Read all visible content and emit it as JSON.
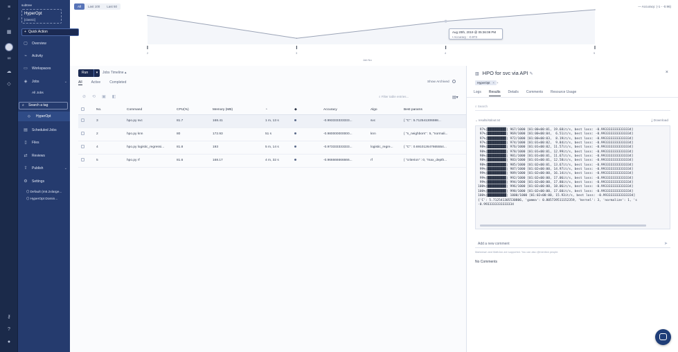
{
  "workspace": {
    "label": "subtree"
  },
  "project": {
    "name": "HyperOpt",
    "tag": "[classic]"
  },
  "sidebar": {
    "quick_action": "Quick Action",
    "items": [
      {
        "label": "Overview",
        "icon": "overview-icon"
      },
      {
        "label": "Activity",
        "icon": "activity-icon"
      },
      {
        "label": "Workspaces",
        "icon": "monitor-icon"
      },
      {
        "label": "Jobs",
        "icon": "jobs-icon"
      },
      {
        "label": "Scheduled Jobs",
        "icon": "calendar-icon"
      },
      {
        "label": "Files",
        "icon": "folder-icon"
      },
      {
        "label": "Reviews",
        "icon": "review-icon"
      },
      {
        "label": "Publish",
        "icon": "publish-icon"
      },
      {
        "label": "Settings",
        "icon": "gear-icon"
      }
    ],
    "jobs_sub": "All Jobs",
    "search_tag": "Search a tag",
    "hyperopt_tag": "HyperOpt",
    "settings_sub": [
      "Default (m5.2xlarge...",
      "HyperOpt Domin..."
    ]
  },
  "chart": {
    "filters": [
      "All",
      "Last 100",
      "Last 50"
    ],
    "active_filter": "All",
    "legend": "Accuracy: (-1 - -0.96)",
    "tooltip_line1": "Aug 20th, 2019 @ 05:36:08 PM",
    "tooltip_line2": "• Accuracy : -0.973",
    "xticks": [
      "2",
      "3",
      "4",
      "5"
    ],
    "xlabel": "Job No"
  },
  "chart_data": {
    "type": "line",
    "x": [
      2,
      3,
      4,
      5
    ],
    "series": [
      {
        "values": [
          -0.9667,
          -0.993,
          -0.9733,
          -0.96
        ]
      }
    ],
    "xlabel": "Job No",
    "ylim": [
      -1,
      -0.96
    ]
  },
  "jobs": {
    "run_label": "Run",
    "timeline_label": "Jobs Timeline",
    "tabs": [
      "All",
      "Active",
      "Completed"
    ],
    "show_archived": "Show Archived",
    "filter_placeholder": "Filter table entries...",
    "columns": [
      "No.",
      "Command",
      "CPU(%)",
      "Memory (MB)",
      "",
      "",
      "Accuracy",
      "Algo",
      "Best params"
    ],
    "rows": [
      {
        "no": "3",
        "command": "hpo.py svc",
        "cpu": "81.7",
        "mem": "168.41",
        "dur": "1 m, 13 s",
        "acc": "-0.993333333333...",
        "algo": "svc",
        "params": "{ \"C\" : 5.712541306598..."
      },
      {
        "no": "2",
        "command": "hpo.py knn",
        "cpu": "80",
        "mem": "172.93",
        "dur": "51 s",
        "acc": "-0.980000000000...",
        "algo": "knn",
        "params": "{ \"n_neighbors\" : 5, \"normali..."
      },
      {
        "no": "4",
        "command": "hpo.py logistic_regressi...",
        "cpu": "81.8",
        "mem": "193",
        "dur": "5 m, 14 s",
        "acc": "-0.973333333333...",
        "algo": "logistic_regre...",
        "params": "{ \"C\" : 0.691012647665554..."
      },
      {
        "no": "5",
        "command": "hpo.py rf",
        "cpu": "81.6",
        "mem": "168.17",
        "dur": "4 m, 32 s",
        "acc": "-0.966666666666...",
        "algo": "rf",
        "params": "{ \"criterion\" : 0, \"max_depth..."
      }
    ]
  },
  "detail": {
    "title": "HPO for svc via API",
    "tag": "HyperOpt",
    "tabs": [
      "Logs",
      "Results",
      "Details",
      "Comments",
      "Resource Usage"
    ],
    "active_tab": "Results",
    "search_placeholder": "Search",
    "file_path": "results/stdout.txt",
    "download": "Download",
    "console": [
      " 97%|█████████▉| 967/1000 [01:00<00:01, 19.68it/s, best loss: -0.9933333333333334]",
      " 97%|█████████▉| 969/1000 [01:00<00:04,  6.51it/s, best loss: -0.9933333333333334]",
      " 97%|█████████▉| 972/1000 [01:00<00:03,  8.19it/s, best loss: -0.9933333333333334]",
      " 97%|█████████▉| 974/1000 [01:01<00:02,  9.84it/s, best loss: -0.9933333333333334]",
      " 98%|█████████▉| 976/1000 [01:01<00:02, 11.57it/s, best loss: -0.9933333333333334]",
      " 98%|█████████▉| 978/1000 [01:01<00:01, 12.99it/s, best loss: -0.9933333333333334]",
      " 98%|█████████▉| 981/1000 [01:01<00:01, 11.67it/s, best loss: -0.9933333333333334]",
      " 98%|█████████▉| 983/1000 [01:01<00:01, 12.58it/s, best loss: -0.9933333333333334]",
      " 98%|█████████▉| 985/1000 [01:02<00:01, 13.67it/s, best loss: -0.9933333333333334]",
      " 99%|█████████▉| 987/1000 [01:02<00:00, 14.97it/s, best loss: -0.9933333333333334]",
      " 99%|█████████▉| 989/1000 [01:02<00:00, 16.14it/s, best loss: -0.9933333333333334]",
      " 99%|█████████▉| 992/1000 [01:02<00:00, 17.06it/s, best loss: -0.9933333333333334]",
      " 99%|█████████▉| 994/1000 [01:02<00:00, 17.80it/s, best loss: -0.9933333333333334]",
      "100%|█████████▉| 996/1000 [01:02<00:00, 18.06it/s, best loss: -0.9933333333333334]",
      "100%|█████████▉| 998/1000 [01:02<00:00, 17.60it/s, best loss: -0.9933333333333334]",
      "100%|██████████| 1000/1000 [01:02<00:00, 15.93it/s, best loss: -0.9933333333333334]",
      "{'C': 5.712541305530806, 'gamma': 0.805739511152359, 'kernel': 3, 'normalize': 1, 's",
      "-0.9933333333333334"
    ],
    "comment_placeholder": "Add a new comment",
    "comment_hint": "Markdown and MathJax are supported. You can also @mention people.",
    "no_comments": "No Comments"
  }
}
